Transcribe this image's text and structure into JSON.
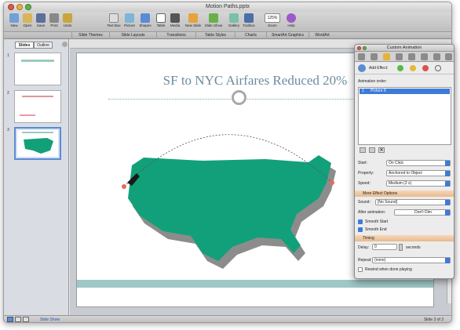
{
  "window": {
    "title": "Motion Paths.pptx"
  },
  "toolbar": {
    "items": [
      "New",
      "Open",
      "Save",
      "Print",
      "Undo",
      "Text Box",
      "Picture",
      "Shapes",
      "Table",
      "Media",
      "New Slide",
      "Slide Show",
      "Gallery",
      "Toolbox",
      "Zoom",
      "Help"
    ],
    "zoom_value": "125%"
  },
  "ribbon": {
    "tabs": [
      "Slide Themes",
      "Slide Layouts",
      "Transitions",
      "Table Styles",
      "Charts",
      "SmartArt Graphics",
      "WordArt"
    ]
  },
  "sidebar": {
    "tabs": [
      "Slides",
      "Outline"
    ],
    "slide_numbers": [
      "1",
      "2",
      "3"
    ],
    "selected_slide": 3
  },
  "slide": {
    "title": "SF to NYC Airfares Reduced 20%",
    "map_color": "#12a07a",
    "accent_color": "#6c8ca0"
  },
  "statusbar": {
    "view_label": "Slide Show",
    "slide_counter": "Slide 3 of 3"
  },
  "panel": {
    "title": "Custom Animation",
    "add_effect_label": "Add Effect:",
    "animation_order_label": "Animation order:",
    "animation_items": [
      {
        "number": "1",
        "name": "Picture 6"
      }
    ],
    "start_label": "Start:",
    "start_value": "On Click",
    "property_label": "Property:",
    "property_value": "Anchored to Object",
    "speed_label": "Speed:",
    "speed_value": "Medium (2 s)",
    "more_options_title": "More Effect Options",
    "sound_label": "Sound:",
    "sound_value": "[No Sound]",
    "after_animation_label": "After animation:",
    "after_animation_value": "Don't Dim",
    "smooth_start_label": "Smooth Start",
    "smooth_end_label": "Smooth End",
    "timing_title": "Timing",
    "delay_label": "Delay:",
    "delay_value": "0",
    "seconds_label": "seconds",
    "repeat_label": "Repeat:",
    "repeat_value": "(none)",
    "rewind_label": "Rewind when done playing"
  }
}
